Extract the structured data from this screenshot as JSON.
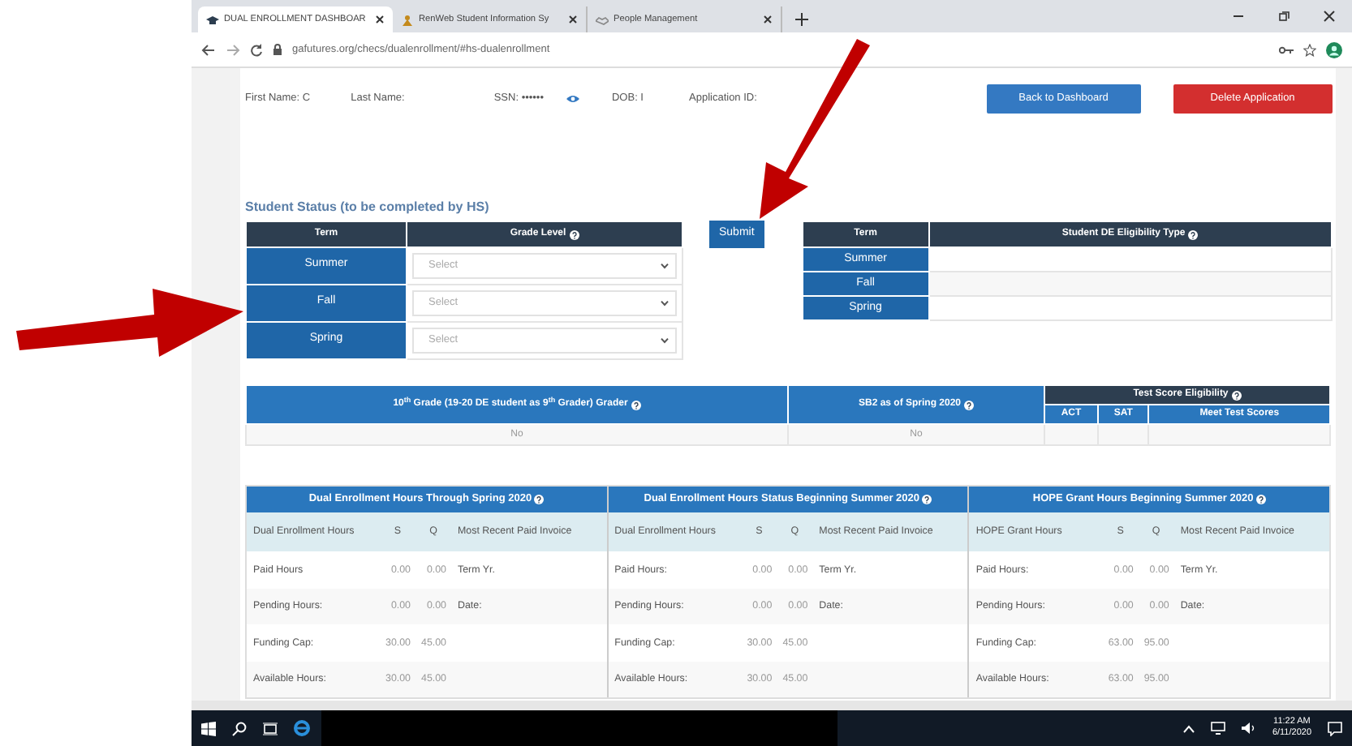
{
  "browser": {
    "tabs": [
      {
        "title": "DUAL ENROLLMENT DASHBOAR",
        "selected": true
      },
      {
        "title": "RenWeb Student Information Sy",
        "selected": false
      },
      {
        "title": "People Management",
        "selected": false
      }
    ],
    "url": "gafutures.org/checs/dualenrollment/#hs-dualenrollment"
  },
  "header": {
    "fields": [
      {
        "label": "First Name: C",
        "kind": "text"
      },
      {
        "label": "Last Name:",
        "kind": "text"
      },
      {
        "label": "SSN: ••••••",
        "kind": "secret"
      },
      {
        "label": "DOB: I",
        "kind": "text"
      },
      {
        "label": "Application ID:",
        "kind": "text"
      }
    ],
    "buttons": [
      {
        "label": "Back to Dashboard",
        "kind": "primary"
      },
      {
        "label": "Delete Application",
        "kind": "danger"
      }
    ]
  },
  "student_status": {
    "title": "Student Status (to be completed by HS)",
    "columns": [
      {
        "label": "Term",
        "help": false
      },
      {
        "label": "Grade Level",
        "help": true
      }
    ],
    "rows": [
      {
        "term": "Summer",
        "placeholder": "Select"
      },
      {
        "term": "Fall",
        "placeholder": "Select"
      },
      {
        "term": "Spring",
        "placeholder": "Select"
      }
    ]
  },
  "submit": "Submit",
  "de_eligibility": {
    "columns": [
      {
        "label": "Term",
        "help": false
      },
      {
        "label": "Student DE Eligibility Type",
        "help": true
      }
    ],
    "rows": [
      "Summer",
      "Fall",
      "Spring"
    ]
  },
  "eligibility_summary": {
    "columns": [
      {
        "label": "10$^{th}$ Grade (19-20 DE student as 9$^{th}$ Grader) Grader",
        "help": true
      },
      {
        "label": "SB2 as of Spring 2020",
        "help": true
      }
    ],
    "test_score": {
      "title": "Test Score Eligibility",
      "help": true,
      "columns": [
        "ACT",
        "SAT",
        "Meet Test Scores"
      ]
    },
    "values": [
      "No",
      "No"
    ]
  },
  "hours": [
    {
      "title": "Dual Enrollment Hours Through Spring 2020",
      "columns": [
        "Dual Enrollment Hours",
        "S",
        "Q",
        "Most Recent Paid Invoice"
      ],
      "rows": [
        [
          "Paid Hours",
          "0.00",
          "0.00",
          "Term Yr."
        ],
        [
          "Pending Hours:",
          "0.00",
          "0.00",
          "Date:"
        ],
        [
          "Funding Cap:",
          "30.00",
          "45.00"
        ],
        [
          "Available Hours:",
          "30.00",
          "45.00"
        ]
      ]
    },
    {
      "title": "Dual Enrollment Hours Status Beginning Summer 2020",
      "columns": [
        "Dual Enrollment Hours",
        "S",
        "Q",
        "Most Recent Paid Invoice"
      ],
      "rows": [
        [
          "Paid Hours:",
          "0.00",
          "0.00",
          "Term Yr."
        ],
        [
          "Pending Hours:",
          "0.00",
          "0.00",
          "Date:"
        ],
        [
          "Funding Cap:",
          "30.00",
          "45.00"
        ],
        [
          "Available Hours:",
          "30.00",
          "45.00"
        ]
      ]
    },
    {
      "title": "HOPE Grant Hours Beginning Summer 2020",
      "columns": [
        "HOPE Grant Hours",
        "S",
        "Q",
        "Most Recent Paid Invoice"
      ],
      "rows": [
        [
          "Paid Hours:",
          "0.00",
          "0.00",
          "Term Yr."
        ],
        [
          "Pending Hours:",
          "0.00",
          "0.00",
          "Date:"
        ],
        [
          "Funding Cap:",
          "63.00",
          "95.00"
        ],
        [
          "Available Hours:",
          "63.00",
          "95.00"
        ]
      ]
    }
  ],
  "taskbar": {
    "time": "11:22 AM",
    "date": "6/11/2020"
  }
}
